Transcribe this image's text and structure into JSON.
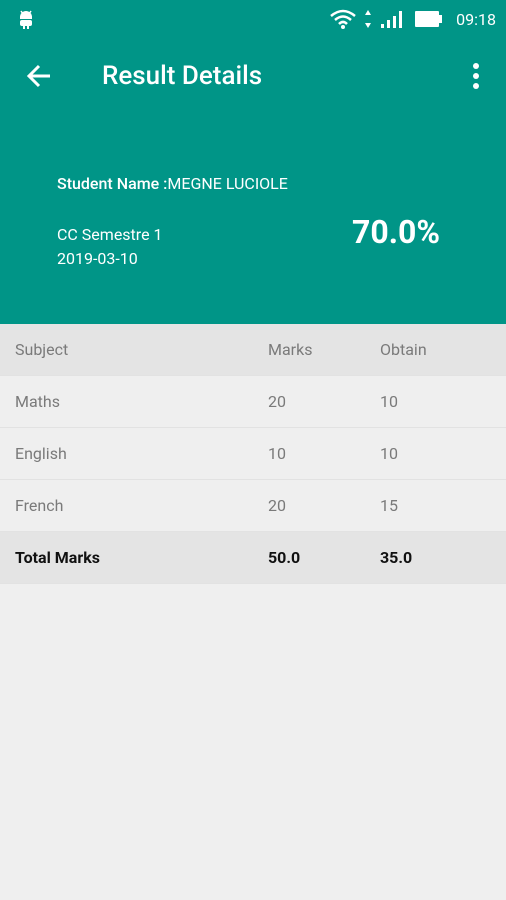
{
  "status_bar": {
    "time": "09:18",
    "icons": [
      "android-icon",
      "wifi-icon",
      "data-transfer-icon",
      "cellular-signal-icon",
      "battery-icon"
    ]
  },
  "app_bar": {
    "title": "Result Details",
    "back_icon": "arrow-left-icon",
    "menu_icon": "more-vertical-icon"
  },
  "header": {
    "student_label": "Student Name :",
    "student_name": "MEGNE LUCIOLE",
    "semester": "CC Semestre 1",
    "date": "2019-03-10",
    "percentage": "70.0%"
  },
  "table": {
    "headers": [
      "Subject",
      "Marks",
      "Obtain"
    ],
    "rows": [
      [
        "Maths",
        "20",
        "10"
      ],
      [
        "English",
        "10",
        "10"
      ],
      [
        "French",
        "20",
        "15"
      ]
    ],
    "total": [
      "Total Marks",
      "50.0",
      "35.0"
    ]
  },
  "colors": {
    "primary": "#009587",
    "background": "#efefef",
    "header_row": "#e4e4e4"
  }
}
